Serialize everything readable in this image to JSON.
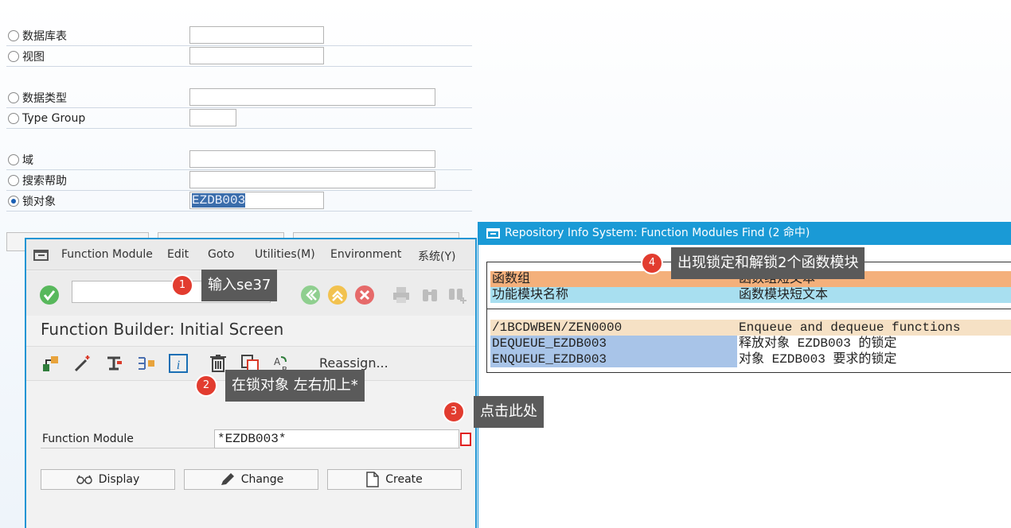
{
  "background_form": {
    "options": [
      {
        "label": "数据库表",
        "value": "",
        "selected": false
      },
      {
        "label": "视图",
        "value": "",
        "selected": false
      },
      {
        "label": "数据类型",
        "value": "",
        "selected": false
      },
      {
        "label": "Type Group",
        "value": "",
        "selected": false
      },
      {
        "label": "域",
        "value": "",
        "selected": false
      },
      {
        "label": "搜索帮助",
        "value": "",
        "selected": false
      },
      {
        "label": "锁对象",
        "value": "EZDB003",
        "selected": true
      }
    ]
  },
  "function_builder": {
    "menu": [
      "Function Module",
      "Edit",
      "Goto",
      "Utilities(M)",
      "Environment",
      "系统(Y)"
    ],
    "title": "Function Builder: Initial Screen",
    "reassign_label": "Reassign...",
    "field_label": "Function Module",
    "field_value": "*EZDB003*",
    "buttons": {
      "display": "Display",
      "change": "Change",
      "create": "Create"
    }
  },
  "repository_info": {
    "title": "Repository Info System: Function Modules Find (2 命中)",
    "header": {
      "group_label": "函数组",
      "group_desc_label": "函数组短文本",
      "name_label": "功能模块名称",
      "name_desc_label": "函数模块短文本"
    },
    "group_row": {
      "name": "/1BCDWBEN/ZEN0000",
      "desc": "Enqueue and dequeue functions"
    },
    "rows": [
      {
        "name": "DEQUEUE_EZDB003",
        "desc": "释放对象 EZDB003 的锁定"
      },
      {
        "name": "ENQUEUE_EZDB003",
        "desc": "对象 EZDB003 要求的锁定"
      }
    ]
  },
  "callouts": [
    {
      "num": "1",
      "text": "输入se37"
    },
    {
      "num": "2",
      "text": "在锁对象 左右加上*"
    },
    {
      "num": "3",
      "text": "点击此处"
    },
    {
      "num": "4",
      "text": "出现锁定和解锁2个函数模块"
    }
  ],
  "colors": {
    "accent": "#1a9ad6",
    "group_header": "#f4b07b",
    "name_header": "#a8dff0",
    "row_highlight": "#a8c4e8",
    "group_row": "#f6e1c5",
    "callout_bg": "#5a5a5a",
    "badge": "#e23c2f"
  }
}
